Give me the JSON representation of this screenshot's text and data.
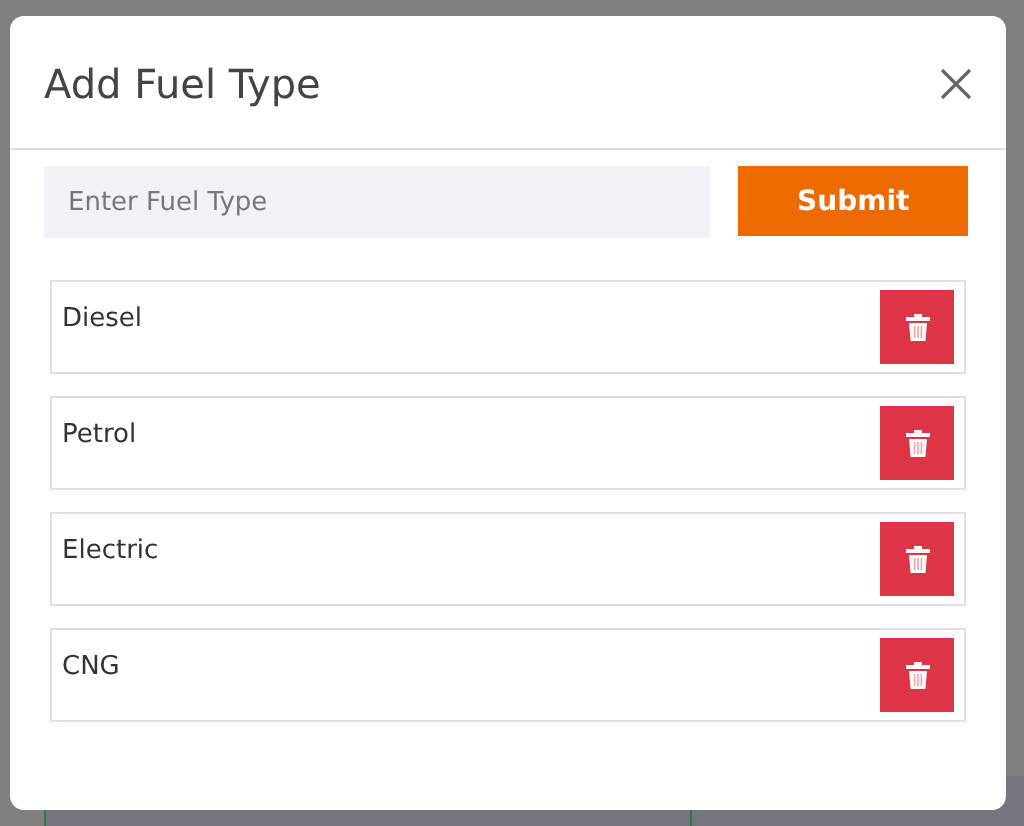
{
  "modal": {
    "title": "Add Fuel Type",
    "input": {
      "placeholder": "Enter Fuel Type"
    },
    "submit": "Submit",
    "items": [
      {
        "name": "Diesel"
      },
      {
        "name": "Petrol"
      },
      {
        "name": "Electric"
      },
      {
        "name": "CNG"
      }
    ]
  }
}
